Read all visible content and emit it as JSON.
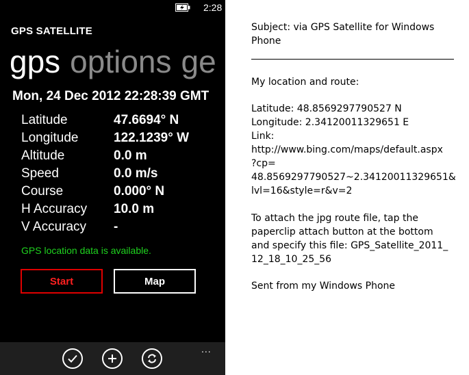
{
  "status": {
    "time": "2:28"
  },
  "app": {
    "title": "GPS SATELLITE"
  },
  "pivot": [
    "gps",
    "options",
    "ge"
  ],
  "datetime": "Mon, 24 Dec 2012 22:28:39 GMT",
  "readings": [
    {
      "label": "Latitude",
      "value": "47.6694° N"
    },
    {
      "label": "Longitude",
      "value": "122.1239° W"
    },
    {
      "label": "Altitude",
      "value": "0.0 m"
    },
    {
      "label": "Speed",
      "value": "0.0 m/s"
    },
    {
      "label": "Course",
      "value": "0.000° N"
    },
    {
      "label": "H Accuracy",
      "value": "10.0 m"
    },
    {
      "label": "V Accuracy",
      "value": "-"
    }
  ],
  "gps_status": "GPS location data is available.",
  "buttons": {
    "start": "Start",
    "map": "Map"
  },
  "app_bar": {
    "icons": [
      "check-icon",
      "add-icon",
      "refresh-icon"
    ],
    "more": "..."
  },
  "email": {
    "subject_lines": [
      "Subject:  via GPS Satellite for Windows",
      "Phone"
    ],
    "body_lines": [
      "My location and route:",
      "",
      "Latitude:  48.8569297790527 N",
      "Longitude:  2.34120011329651  E",
      "Link:",
      "http://www.bing.com/maps/default.aspx",
      "?cp=",
      "48.8569297790527~2.34120011329651&",
      "lvl=16&style=r&v=2",
      "",
      "To attach the jpg route file, tap the",
      "paperclip attach button at the bottom",
      "and specify this file:   GPS_Satellite_2011_",
      "12_18_10_25_56",
      "",
      "Sent from my Windows Phone"
    ]
  },
  "colors": {
    "start_border": "#e00000",
    "status_green": "#1fd31f",
    "appbar_bg": "#1f1f1f"
  }
}
